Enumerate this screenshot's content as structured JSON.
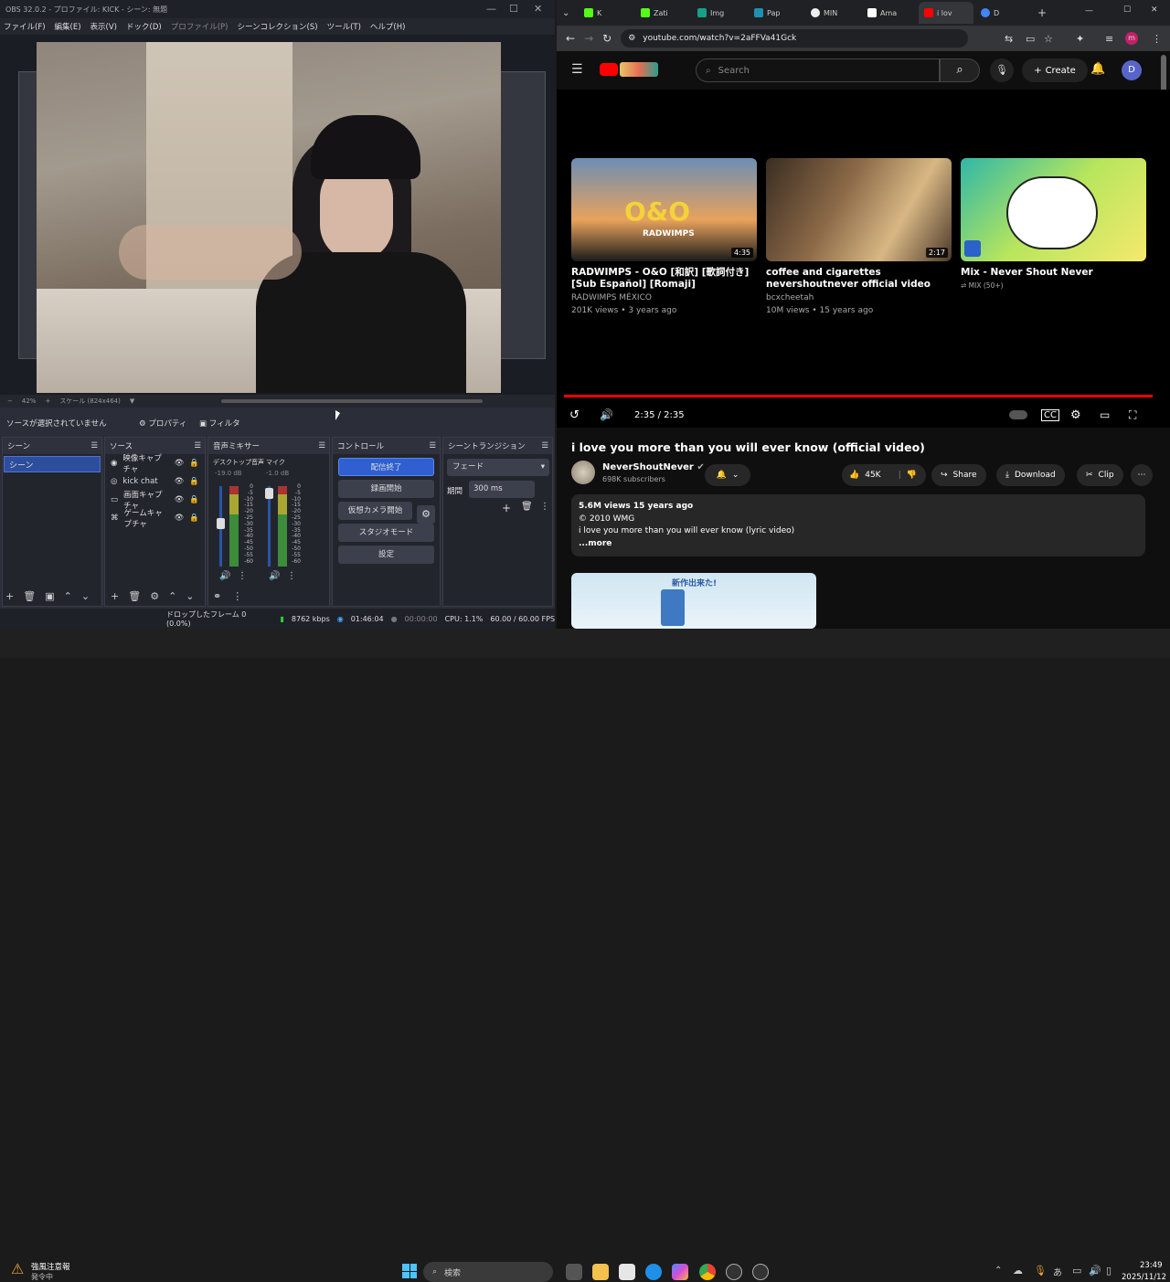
{
  "obs": {
    "title": "OBS 32.0.2 - プロファイル: KICK - シーン: 無題",
    "menu": [
      "ファイル(F)",
      "編集(E)",
      "表示(V)",
      "ドック(D)",
      "プロファイル(P)",
      "シーンコレクション(S)",
      "ツール(T)",
      "ヘルプ(H)"
    ],
    "zoom": "42%",
    "scale": "スケール (824x464)",
    "no_source": "ソースが選択されていません",
    "properties": "プロパティ",
    "filters": "フィルタ",
    "scenes_title": "シーン",
    "scene_item": "シーン",
    "sources_title": "ソース",
    "sources": [
      "映像キャプチャ",
      "kick chat",
      "画面キャプチャ",
      "ゲームキャプチャ"
    ],
    "mixer_title": "音声ミキサー",
    "desktop_audio": "デスクトップ音声",
    "desktop_db": "-19.0 dB",
    "mic": "マイク",
    "mic_db": "-1.0 dB",
    "meter_ticks": [
      "0",
      "-5",
      "-10",
      "-15",
      "-20",
      "-25",
      "-30",
      "-35",
      "-40",
      "-45",
      "-50",
      "-55",
      "-60"
    ],
    "controls_title": "コントロール",
    "controls": [
      "配信終了",
      "録画開始",
      "仮想カメラ開始",
      "スタジオモード",
      "設定"
    ],
    "transition_title": "シーントランジション",
    "transition": "フェード",
    "duration_label": "期間",
    "duration": "300 ms",
    "status": {
      "dropped": "ドロップしたフレーム 0 (0.0%)",
      "kbps": "8762 kbps",
      "live": "01:46:04",
      "rec": "00:00:00",
      "cpu": "CPU: 1.1%",
      "fps": "60.00 / 60.00 FPS"
    }
  },
  "browser": {
    "tabs": [
      "K",
      "Zati",
      "Img",
      "Pap",
      "MIN",
      "Ama",
      "i lov",
      "D"
    ],
    "url": "youtube.com/watch?v=2aFFVa41Gck",
    "search_placeholder": "Search",
    "create": "Create",
    "avatar": "D",
    "cards": [
      {
        "title": "RADWIMPS - O&O [和訳] [歌詞付き] [Sub Español] [Romaji]",
        "channel": "RADWIMPS MÉXICO",
        "meta": "201K views • 3 years ago",
        "duration": "4:35",
        "thumb_text": "O&O",
        "thumb_sub": "RADWIMPS"
      },
      {
        "title": "coffee and cigarettes nevershoutnever official video",
        "channel": "bcxcheetah",
        "meta": "10M views • 15 years ago",
        "duration": "2:17"
      },
      {
        "title": "Mix - Never Shout Never",
        "channel": "MIX (50+)",
        "meta": ""
      }
    ],
    "time": "2:35 / 2:35",
    "video_title": "i love you more than you will ever know (official video)",
    "channel": "NeverShoutNever",
    "subs": "698K subscribers",
    "likes": "45K",
    "share": "Share",
    "download": "Download",
    "clip": "Clip",
    "desc_line1": "5.6M views  15 years ago",
    "desc_line2": "© 2010 WMG",
    "desc_line3": "i love you more than you will ever know (lyric video)",
    "more": "...more",
    "ad_text": "新作出来た!"
  },
  "taskbar": {
    "weather": "強風注意報",
    "weather_sub": "発令中",
    "search": "検索",
    "time": "23:49",
    "date": "2025/11/12",
    "ime": "あ"
  }
}
